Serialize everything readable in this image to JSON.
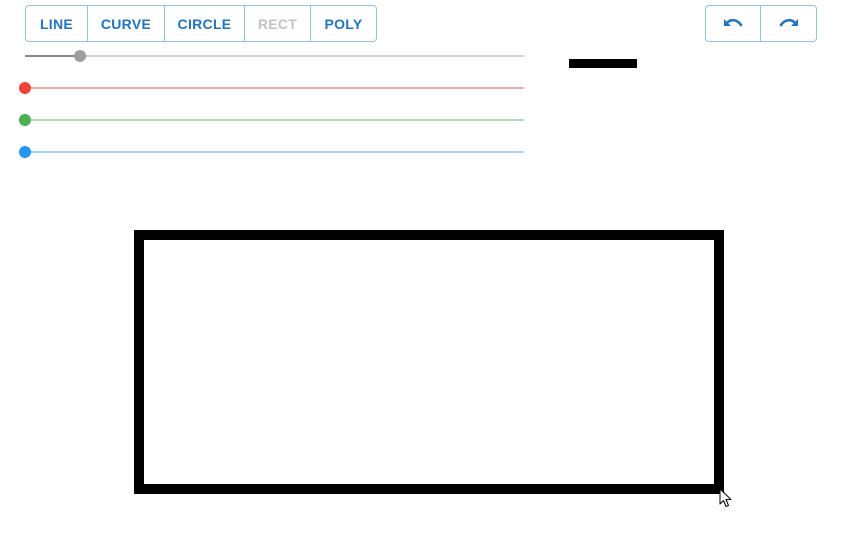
{
  "tools": [
    {
      "label": "LINE",
      "active": true
    },
    {
      "label": "CURVE",
      "active": true
    },
    {
      "label": "CIRCLE",
      "active": true
    },
    {
      "label": "RECT",
      "active": false,
      "selected": true
    },
    {
      "label": "POLY",
      "active": true
    }
  ],
  "history": {
    "undo_icon": "undo-icon",
    "redo_icon": "redo-icon"
  },
  "sliders": {
    "stroke_width": {
      "value_fraction": 0.11,
      "color": "#9e9e9e"
    },
    "red": {
      "value_fraction": 0.0,
      "color": "#f44336"
    },
    "green": {
      "value_fraction": 0.0,
      "color": "#4caf50"
    },
    "blue": {
      "value_fraction": 0.0,
      "color": "#2196f3"
    }
  },
  "stroke_preview": {
    "color": "#000000"
  },
  "colors": {
    "accent": "#1f74c6",
    "border": "#8fc3ea",
    "disabled": "#c2c2c2"
  }
}
